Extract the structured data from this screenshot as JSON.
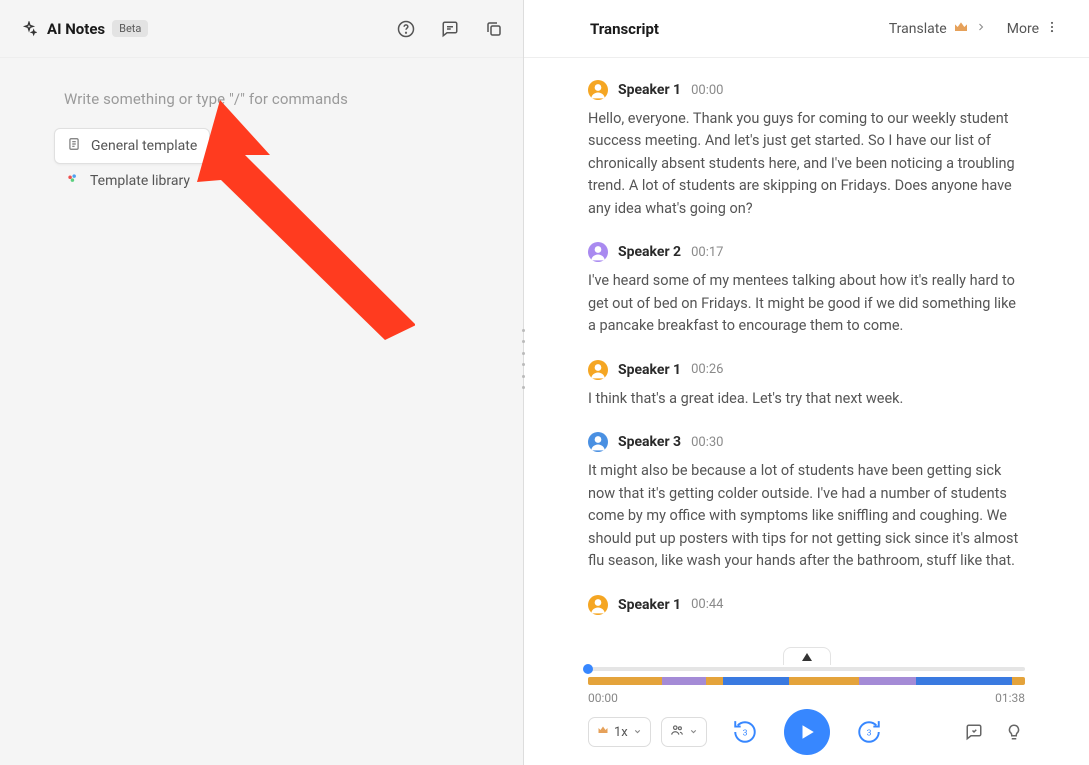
{
  "left": {
    "brand": {
      "title": "AI Notes",
      "badge": "Beta"
    },
    "placeholder": "Write something or type \"/\" for commands",
    "templates": [
      {
        "label": "General template",
        "icon": "doc-icon",
        "active": true
      },
      {
        "label": "Template library",
        "icon": "palette-icon",
        "active": false
      }
    ]
  },
  "right": {
    "title": "Transcript",
    "translate_label": "Translate",
    "more_label": "More"
  },
  "segments": [
    {
      "speaker": "Speaker 1",
      "time": "00:00",
      "color": "orange",
      "text": "Hello, everyone. Thank you guys for coming to our weekly student success meeting. And let's just get started. So I have our list of chronically absent students here, and I've been noticing a troubling trend. A lot of students are skipping on Fridays. Does anyone have any idea what's going on?"
    },
    {
      "speaker": "Speaker 2",
      "time": "00:17",
      "color": "purple",
      "text": "I've heard some of my mentees talking about how it's really hard to get out of bed on Fridays. It might be good if we did something like a pancake breakfast to encourage them to come."
    },
    {
      "speaker": "Speaker 1",
      "time": "00:26",
      "color": "orange",
      "text": "I think that's a great idea. Let's try that next week."
    },
    {
      "speaker": "Speaker 3",
      "time": "00:30",
      "color": "blue",
      "text": "It might also be because a lot of students have been getting sick now that it's getting colder outside. I've had a number of students come by my office with symptoms like sniffling and coughing. We should put up posters with tips for not getting sick since it's almost flu season, like wash your hands after the bathroom, stuff like that."
    },
    {
      "speaker": "Speaker 1",
      "time": "00:44",
      "color": "orange",
      "text": ""
    }
  ],
  "player": {
    "current": "00:00",
    "duration": "01:38",
    "speed": "1x",
    "bar_segments": [
      {
        "color": "#e4a33b",
        "width": 17
      },
      {
        "color": "#a48bd6",
        "width": 10
      },
      {
        "color": "#e4a33b",
        "width": 4
      },
      {
        "color": "#3a7ae0",
        "width": 15
      },
      {
        "color": "#e4a33b",
        "width": 16
      },
      {
        "color": "#a48bd6",
        "width": 13
      },
      {
        "color": "#3a7ae0",
        "width": 22
      },
      {
        "color": "#e4a33b",
        "width": 3
      }
    ]
  }
}
